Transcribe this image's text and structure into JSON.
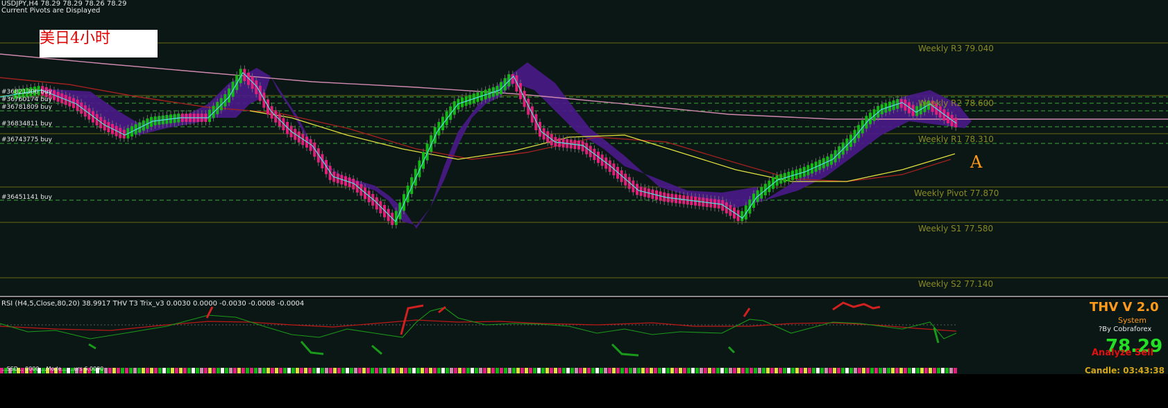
{
  "header": {
    "symbol_info": "USDJPY,H4  78.29 78.29 78.26 78.29",
    "pivots_displayed": "Current Pivots are Displayed"
  },
  "note": {
    "text": "美日4小时"
  },
  "tickets": [
    {
      "label": "#36821306 buy"
    },
    {
      "label": "#36760174 buy"
    },
    {
      "label": "#36781809 buy"
    },
    {
      "label": "#36834811 buy"
    },
    {
      "label": "#36743775 buy"
    },
    {
      "label": "#36451141 buy"
    }
  ],
  "pivot_levels": [
    {
      "label": "Weekly R3 79.040"
    },
    {
      "label": "Weekly R2 78.600"
    },
    {
      "label": "Weekly R1 78.310"
    },
    {
      "label": "Weekly Pivot 77.870"
    },
    {
      "label": "Weekly S1 77.580"
    },
    {
      "label": "Weekly S2 77.140"
    }
  ],
  "marker": "A",
  "indicator": {
    "label": "RSI (H4,5,Close,80,20) 38.9917    THV T3 Trix_v3   0.0030 0.0000 -0.0030 -0.0008 -0.0004"
  },
  "thv_panel": {
    "title": "THV V 2.0",
    "system": "System",
    "by": "?By Cobraforex",
    "price": "78.29",
    "analyze": "Analyze Sell"
  },
  "bottom_strip": {
    "text": "...SSD... 0000  ...Mode...  ...urs 6.0000",
    "candle_timer": "Candle:  03:43:38"
  },
  "colors": {
    "background": "#0b1714",
    "bull_candle": "#14b814",
    "bear_candle": "#e0207a",
    "cloud": "#4a1a8a",
    "cyan_ma": "#4ee0e0",
    "yellow_ma": "#e0e040",
    "red_ma": "#a02020",
    "pink_ma": "#d08ab0",
    "pivot_solid": "#6a6a10",
    "pivot_dashed": "#3aa83a",
    "label_olive": "#8a8a22",
    "marker_orange": "#ff9a1a"
  }
}
